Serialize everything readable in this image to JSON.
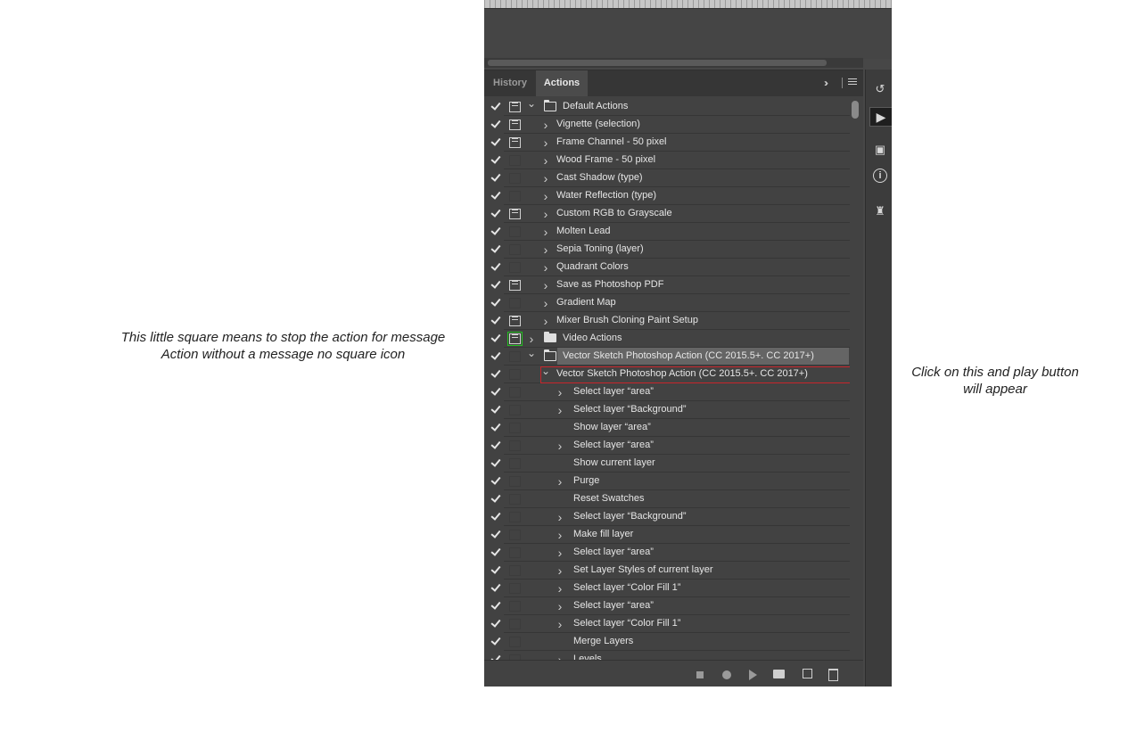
{
  "annotations": {
    "left_line1": "This little square means to stop the action for message",
    "left_line2": "Action without a message no square icon",
    "right_line1": "Click on this and play button",
    "right_line2": "will appear"
  },
  "tabs": {
    "history": "History",
    "actions": "Actions"
  },
  "rows": [
    {
      "label": "Default Actions",
      "type": "set",
      "open": true,
      "dialog": true
    },
    {
      "label": "Vignette (selection)",
      "type": "action",
      "dialog": true
    },
    {
      "label": "Frame Channel - 50 pixel",
      "type": "action",
      "dialog": true
    },
    {
      "label": "Wood Frame - 50 pixel",
      "type": "action",
      "dialog": false
    },
    {
      "label": "Cast Shadow (type)",
      "type": "action",
      "dialog": false
    },
    {
      "label": "Water Reflection (type)",
      "type": "action",
      "dialog": false
    },
    {
      "label": "Custom RGB to Grayscale",
      "type": "action",
      "dialog": true
    },
    {
      "label": "Molten Lead",
      "type": "action",
      "dialog": false
    },
    {
      "label": "Sepia Toning (layer)",
      "type": "action",
      "dialog": false
    },
    {
      "label": "Quadrant Colors",
      "type": "action",
      "dialog": false
    },
    {
      "label": "Save as Photoshop PDF",
      "type": "action",
      "dialog": true
    },
    {
      "label": "Gradient Map",
      "type": "action",
      "dialog": false
    },
    {
      "label": "Mixer Brush Cloning Paint Setup",
      "type": "action",
      "dialog": true
    },
    {
      "label": "Video Actions",
      "type": "set",
      "open": false,
      "dialog": true,
      "highlight": true
    },
    {
      "label": "Vector Sketch Photoshop Action (CC 2015.5+. CC 2017+)",
      "type": "set",
      "open": true,
      "dialog": false,
      "selected": true
    },
    {
      "label": "Vector Sketch Photoshop Action (CC 2015.5+. CC 2017+)",
      "type": "action",
      "open": true,
      "dialog": false
    },
    {
      "label": "Select layer “area”",
      "type": "step",
      "expand": true
    },
    {
      "label": "Select layer “Background”",
      "type": "step",
      "expand": true
    },
    {
      "label": "Show layer “area”",
      "type": "step",
      "expand": false
    },
    {
      "label": "Select layer “area”",
      "type": "step",
      "expand": true
    },
    {
      "label": "Show current layer",
      "type": "step",
      "expand": false
    },
    {
      "label": "Purge",
      "type": "step",
      "expand": true
    },
    {
      "label": "Reset Swatches",
      "type": "step",
      "expand": false
    },
    {
      "label": "Select layer “Background”",
      "type": "step",
      "expand": true
    },
    {
      "label": "Make fill layer",
      "type": "step",
      "expand": true
    },
    {
      "label": "Select layer “area”",
      "type": "step",
      "expand": true
    },
    {
      "label": "Set Layer Styles of current layer",
      "type": "step",
      "expand": true
    },
    {
      "label": "Select layer “Color Fill 1”",
      "type": "step",
      "expand": true
    },
    {
      "label": "Select layer “area”",
      "type": "step",
      "expand": true
    },
    {
      "label": "Select layer “Color Fill 1”",
      "type": "step",
      "expand": true
    },
    {
      "label": "Merge Layers",
      "type": "step",
      "expand": false
    },
    {
      "label": "Levels",
      "type": "step",
      "expand": true
    }
  ],
  "icons": {
    "checkmark": "check-icon",
    "dialog": "dialog-toggle-icon",
    "folder": "folder-icon",
    "stop": "stop-icon",
    "record": "record-icon",
    "play": "play-icon",
    "new_set": "new-set-icon",
    "new_action": "new-action-icon",
    "trash": "trash-icon"
  },
  "colors": {
    "panel_bg": "#424242",
    "selection": "#656565",
    "highlight_red": "#c8252b",
    "highlight_green": "#22c020"
  }
}
